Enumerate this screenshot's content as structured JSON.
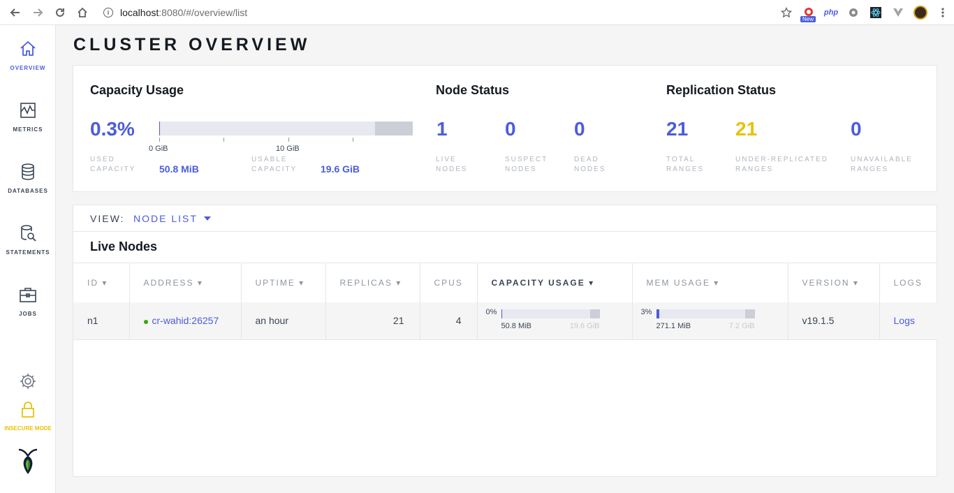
{
  "browser": {
    "url_host": "localhost",
    "url_path": ":8080/#/overview/list",
    "new_badge": "New",
    "php_label": "php"
  },
  "sidebar": {
    "items": [
      {
        "label": "OVERVIEW",
        "icon": "home-icon"
      },
      {
        "label": "METRICS",
        "icon": "chart-icon"
      },
      {
        "label": "DATABASES",
        "icon": "database-icon"
      },
      {
        "label": "STATEMENTS",
        "icon": "statements-icon"
      },
      {
        "label": "JOBS",
        "icon": "briefcase-icon"
      }
    ],
    "insecure_label": "INSECURE MODE"
  },
  "page_title": "CLUSTER OVERVIEW",
  "capacity": {
    "title": "Capacity Usage",
    "percent": "0.3%",
    "used_fraction": 0.003,
    "tick_0": "0 GiB",
    "tick_10": "10 GiB",
    "used_label": "USED CAPACITY",
    "used_value": "50.8 MiB",
    "usable_label": "USABLE CAPACITY",
    "usable_value": "19.6 GiB"
  },
  "node_status": {
    "title": "Node Status",
    "live": "1",
    "live_label": "LIVE NODES",
    "suspect": "0",
    "suspect_label": "SUSPECT NODES",
    "dead": "0",
    "dead_label": "DEAD NODES"
  },
  "replication": {
    "title": "Replication Status",
    "total": "21",
    "total_label": "TOTAL RANGES",
    "under": "21",
    "under_label": "UNDER-REPLICATED RANGES",
    "unavailable": "0",
    "unavailable_label": "UNAVAILABLE RANGES"
  },
  "view": {
    "label": "VIEW:",
    "value": "NODE LIST"
  },
  "live_nodes": {
    "title": "Live Nodes",
    "columns": {
      "id": "ID ▾",
      "address": "ADDRESS ▾",
      "uptime": "UPTIME ▾",
      "replicas": "REPLICAS ▾",
      "cpus": "CPUS",
      "capacity": "CAPACITY USAGE ▾",
      "mem": "MEM USAGE ▾",
      "version": "VERSION ▾",
      "logs": "LOGS"
    },
    "rows": [
      {
        "id": "n1",
        "address": "cr-wahid:26257",
        "uptime": "an hour",
        "replicas": "21",
        "cpus": "4",
        "cap_pct": "0%",
        "cap_fraction": 0.0,
        "cap_used": "50.8 MiB",
        "cap_total": "19.6 GiB",
        "mem_pct": "3%",
        "mem_fraction": 0.03,
        "mem_used": "271.1 MiB",
        "mem_total": "7.2 GiB",
        "version": "v19.1.5",
        "logs": "Logs"
      }
    ]
  },
  "colors": {
    "accent": "#4b5cdd",
    "warning": "#e8c10c",
    "live_dot": "#37a806"
  }
}
